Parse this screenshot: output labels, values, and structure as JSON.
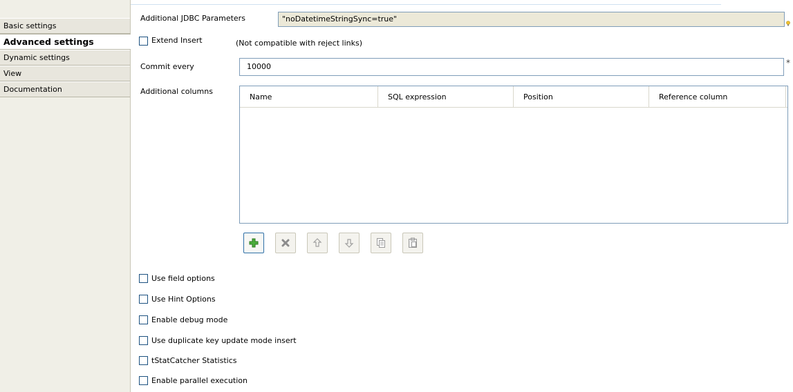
{
  "tabs": [
    {
      "label": "Basic settings",
      "active": false
    },
    {
      "label": "Advanced settings",
      "active": true
    },
    {
      "label": "Dynamic settings",
      "active": false
    },
    {
      "label": "View",
      "active": false
    },
    {
      "label": "Documentation",
      "active": false
    }
  ],
  "jdbc": {
    "label": "Additional JDBC Parameters",
    "value": "\"noDatetimeStringSync=true\""
  },
  "extend_insert": {
    "label": "Extend Insert",
    "checked": false,
    "note": "(Not compatible with reject links)"
  },
  "commit": {
    "label": "Commit every",
    "value": "10000",
    "required_marker": "*"
  },
  "additional_columns": {
    "label": "Additional columns",
    "headers": [
      "Name",
      "SQL expression",
      "Position",
      "Reference column"
    ],
    "rows": []
  },
  "toolbar": {
    "buttons": [
      {
        "name": "add-button",
        "icon": "plus-icon",
        "enabled": true
      },
      {
        "name": "remove-button",
        "icon": "delete-x-icon",
        "enabled": false
      },
      {
        "name": "move-up-button",
        "icon": "arrow-up-icon",
        "enabled": false
      },
      {
        "name": "move-down-button",
        "icon": "arrow-down-icon",
        "enabled": false
      },
      {
        "name": "copy-button",
        "icon": "copy-icon",
        "enabled": false
      },
      {
        "name": "paste-button",
        "icon": "paste-icon",
        "enabled": false
      }
    ]
  },
  "options": [
    {
      "label": "Use field options",
      "checked": false
    },
    {
      "label": "Use Hint Options",
      "checked": false
    },
    {
      "label": "Enable debug mode",
      "checked": false
    },
    {
      "label": "Use duplicate key update mode insert",
      "checked": false
    },
    {
      "label": "tStatCatcher Statistics",
      "checked": false
    },
    {
      "label": "Enable parallel execution",
      "checked": false
    }
  ],
  "colors": {
    "sidebar_bg": "#e8e6dd",
    "field_border": "#7f9db9",
    "readonly_bg": "#ece9d8",
    "add_green": "#3a9c2e",
    "disabled_gray": "#9a9a9a"
  }
}
